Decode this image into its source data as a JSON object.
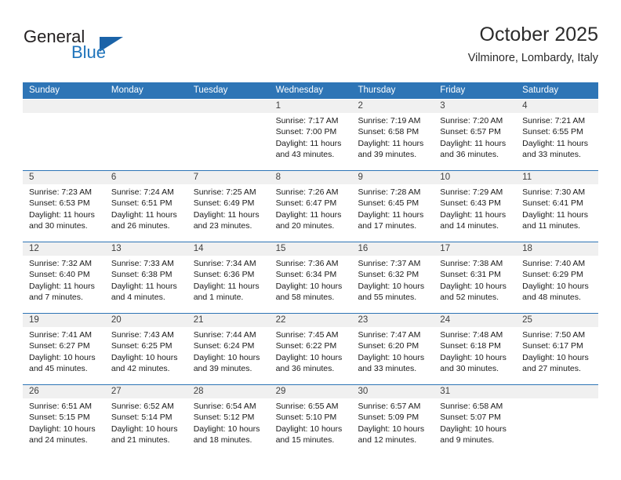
{
  "brand": {
    "name_part1": "General",
    "name_part2": "Blue",
    "triangle_color": "#1b63a8",
    "blue_color": "#1f74bb"
  },
  "header": {
    "title": "October 2025",
    "subtitle": "Vilminore, Lombardy, Italy"
  },
  "theme": {
    "header_bg": "#2e75b6",
    "day_band_bg": "#f0f0f0",
    "text": "#1a1a1a"
  },
  "weekdays": [
    "Sunday",
    "Monday",
    "Tuesday",
    "Wednesday",
    "Thursday",
    "Friday",
    "Saturday"
  ],
  "labels": {
    "sunrise": "Sunrise:",
    "sunset": "Sunset:",
    "daylight": "Daylight:"
  },
  "weeks": [
    [
      {
        "day": "",
        "empty": true
      },
      {
        "day": "",
        "empty": true
      },
      {
        "day": "",
        "empty": true
      },
      {
        "day": "1",
        "sunrise": "Sunrise: 7:17 AM",
        "sunset": "Sunset: 7:00 PM",
        "daylight1": "Daylight: 11 hours",
        "daylight2": "and 43 minutes."
      },
      {
        "day": "2",
        "sunrise": "Sunrise: 7:19 AM",
        "sunset": "Sunset: 6:58 PM",
        "daylight1": "Daylight: 11 hours",
        "daylight2": "and 39 minutes."
      },
      {
        "day": "3",
        "sunrise": "Sunrise: 7:20 AM",
        "sunset": "Sunset: 6:57 PM",
        "daylight1": "Daylight: 11 hours",
        "daylight2": "and 36 minutes."
      },
      {
        "day": "4",
        "sunrise": "Sunrise: 7:21 AM",
        "sunset": "Sunset: 6:55 PM",
        "daylight1": "Daylight: 11 hours",
        "daylight2": "and 33 minutes."
      }
    ],
    [
      {
        "day": "5",
        "sunrise": "Sunrise: 7:23 AM",
        "sunset": "Sunset: 6:53 PM",
        "daylight1": "Daylight: 11 hours",
        "daylight2": "and 30 minutes."
      },
      {
        "day": "6",
        "sunrise": "Sunrise: 7:24 AM",
        "sunset": "Sunset: 6:51 PM",
        "daylight1": "Daylight: 11 hours",
        "daylight2": "and 26 minutes."
      },
      {
        "day": "7",
        "sunrise": "Sunrise: 7:25 AM",
        "sunset": "Sunset: 6:49 PM",
        "daylight1": "Daylight: 11 hours",
        "daylight2": "and 23 minutes."
      },
      {
        "day": "8",
        "sunrise": "Sunrise: 7:26 AM",
        "sunset": "Sunset: 6:47 PM",
        "daylight1": "Daylight: 11 hours",
        "daylight2": "and 20 minutes."
      },
      {
        "day": "9",
        "sunrise": "Sunrise: 7:28 AM",
        "sunset": "Sunset: 6:45 PM",
        "daylight1": "Daylight: 11 hours",
        "daylight2": "and 17 minutes."
      },
      {
        "day": "10",
        "sunrise": "Sunrise: 7:29 AM",
        "sunset": "Sunset: 6:43 PM",
        "daylight1": "Daylight: 11 hours",
        "daylight2": "and 14 minutes."
      },
      {
        "day": "11",
        "sunrise": "Sunrise: 7:30 AM",
        "sunset": "Sunset: 6:41 PM",
        "daylight1": "Daylight: 11 hours",
        "daylight2": "and 11 minutes."
      }
    ],
    [
      {
        "day": "12",
        "sunrise": "Sunrise: 7:32 AM",
        "sunset": "Sunset: 6:40 PM",
        "daylight1": "Daylight: 11 hours",
        "daylight2": "and 7 minutes."
      },
      {
        "day": "13",
        "sunrise": "Sunrise: 7:33 AM",
        "sunset": "Sunset: 6:38 PM",
        "daylight1": "Daylight: 11 hours",
        "daylight2": "and 4 minutes."
      },
      {
        "day": "14",
        "sunrise": "Sunrise: 7:34 AM",
        "sunset": "Sunset: 6:36 PM",
        "daylight1": "Daylight: 11 hours",
        "daylight2": "and 1 minute."
      },
      {
        "day": "15",
        "sunrise": "Sunrise: 7:36 AM",
        "sunset": "Sunset: 6:34 PM",
        "daylight1": "Daylight: 10 hours",
        "daylight2": "and 58 minutes."
      },
      {
        "day": "16",
        "sunrise": "Sunrise: 7:37 AM",
        "sunset": "Sunset: 6:32 PM",
        "daylight1": "Daylight: 10 hours",
        "daylight2": "and 55 minutes."
      },
      {
        "day": "17",
        "sunrise": "Sunrise: 7:38 AM",
        "sunset": "Sunset: 6:31 PM",
        "daylight1": "Daylight: 10 hours",
        "daylight2": "and 52 minutes."
      },
      {
        "day": "18",
        "sunrise": "Sunrise: 7:40 AM",
        "sunset": "Sunset: 6:29 PM",
        "daylight1": "Daylight: 10 hours",
        "daylight2": "and 48 minutes."
      }
    ],
    [
      {
        "day": "19",
        "sunrise": "Sunrise: 7:41 AM",
        "sunset": "Sunset: 6:27 PM",
        "daylight1": "Daylight: 10 hours",
        "daylight2": "and 45 minutes."
      },
      {
        "day": "20",
        "sunrise": "Sunrise: 7:43 AM",
        "sunset": "Sunset: 6:25 PM",
        "daylight1": "Daylight: 10 hours",
        "daylight2": "and 42 minutes."
      },
      {
        "day": "21",
        "sunrise": "Sunrise: 7:44 AM",
        "sunset": "Sunset: 6:24 PM",
        "daylight1": "Daylight: 10 hours",
        "daylight2": "and 39 minutes."
      },
      {
        "day": "22",
        "sunrise": "Sunrise: 7:45 AM",
        "sunset": "Sunset: 6:22 PM",
        "daylight1": "Daylight: 10 hours",
        "daylight2": "and 36 minutes."
      },
      {
        "day": "23",
        "sunrise": "Sunrise: 7:47 AM",
        "sunset": "Sunset: 6:20 PM",
        "daylight1": "Daylight: 10 hours",
        "daylight2": "and 33 minutes."
      },
      {
        "day": "24",
        "sunrise": "Sunrise: 7:48 AM",
        "sunset": "Sunset: 6:18 PM",
        "daylight1": "Daylight: 10 hours",
        "daylight2": "and 30 minutes."
      },
      {
        "day": "25",
        "sunrise": "Sunrise: 7:50 AM",
        "sunset": "Sunset: 6:17 PM",
        "daylight1": "Daylight: 10 hours",
        "daylight2": "and 27 minutes."
      }
    ],
    [
      {
        "day": "26",
        "sunrise": "Sunrise: 6:51 AM",
        "sunset": "Sunset: 5:15 PM",
        "daylight1": "Daylight: 10 hours",
        "daylight2": "and 24 minutes."
      },
      {
        "day": "27",
        "sunrise": "Sunrise: 6:52 AM",
        "sunset": "Sunset: 5:14 PM",
        "daylight1": "Daylight: 10 hours",
        "daylight2": "and 21 minutes."
      },
      {
        "day": "28",
        "sunrise": "Sunrise: 6:54 AM",
        "sunset": "Sunset: 5:12 PM",
        "daylight1": "Daylight: 10 hours",
        "daylight2": "and 18 minutes."
      },
      {
        "day": "29",
        "sunrise": "Sunrise: 6:55 AM",
        "sunset": "Sunset: 5:10 PM",
        "daylight1": "Daylight: 10 hours",
        "daylight2": "and 15 minutes."
      },
      {
        "day": "30",
        "sunrise": "Sunrise: 6:57 AM",
        "sunset": "Sunset: 5:09 PM",
        "daylight1": "Daylight: 10 hours",
        "daylight2": "and 12 minutes."
      },
      {
        "day": "31",
        "sunrise": "Sunrise: 6:58 AM",
        "sunset": "Sunset: 5:07 PM",
        "daylight1": "Daylight: 10 hours",
        "daylight2": "and 9 minutes."
      },
      {
        "day": "",
        "empty": true
      }
    ]
  ]
}
